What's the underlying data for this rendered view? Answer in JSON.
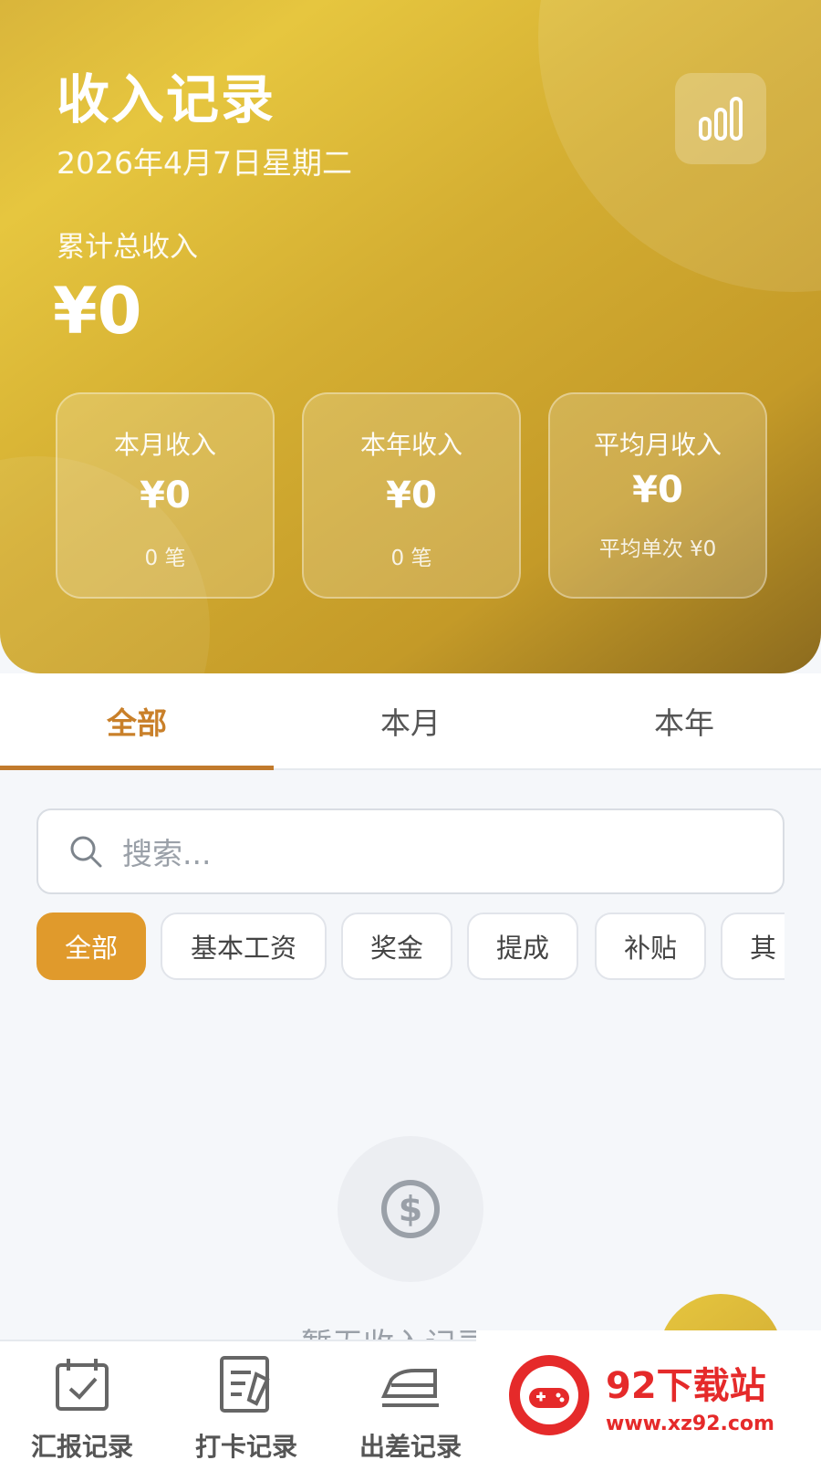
{
  "header": {
    "title": "收入记录",
    "date": "2026年4月7日星期二",
    "total_label": "累计总收入",
    "total_value": "¥0",
    "stats_icon": "bar-chart-icon"
  },
  "stat_cards": [
    {
      "label": "本月收入",
      "value": "¥0",
      "sub": "0 笔"
    },
    {
      "label": "本年收入",
      "value": "¥0",
      "sub": "0 笔"
    },
    {
      "label": "平均月收入",
      "value": "¥0",
      "sub": "平均单次 ¥0"
    }
  ],
  "tabs": [
    {
      "label": "全部",
      "active": true
    },
    {
      "label": "本月",
      "active": false
    },
    {
      "label": "本年",
      "active": false
    }
  ],
  "search": {
    "placeholder": "搜索..."
  },
  "categories": [
    {
      "label": "全部",
      "active": true
    },
    {
      "label": "基本工资"
    },
    {
      "label": "奖金"
    },
    {
      "label": "提成"
    },
    {
      "label": "补贴"
    },
    {
      "label": "其"
    }
  ],
  "empty_state": {
    "icon": "dollar-circle-icon",
    "text": "暂无收入记录"
  },
  "bottom_nav": [
    {
      "label": "汇报记录",
      "icon": "calendar-check-icon"
    },
    {
      "label": "打卡记录",
      "icon": "edit-note-icon"
    },
    {
      "label": "出差记录",
      "icon": "train-icon"
    }
  ],
  "watermark": {
    "title": "92下载站",
    "url": "www.xz92.com"
  },
  "colors": {
    "accent": "#c9802a",
    "chip_active": "#e09a2c",
    "gold": "#d4ae32"
  }
}
